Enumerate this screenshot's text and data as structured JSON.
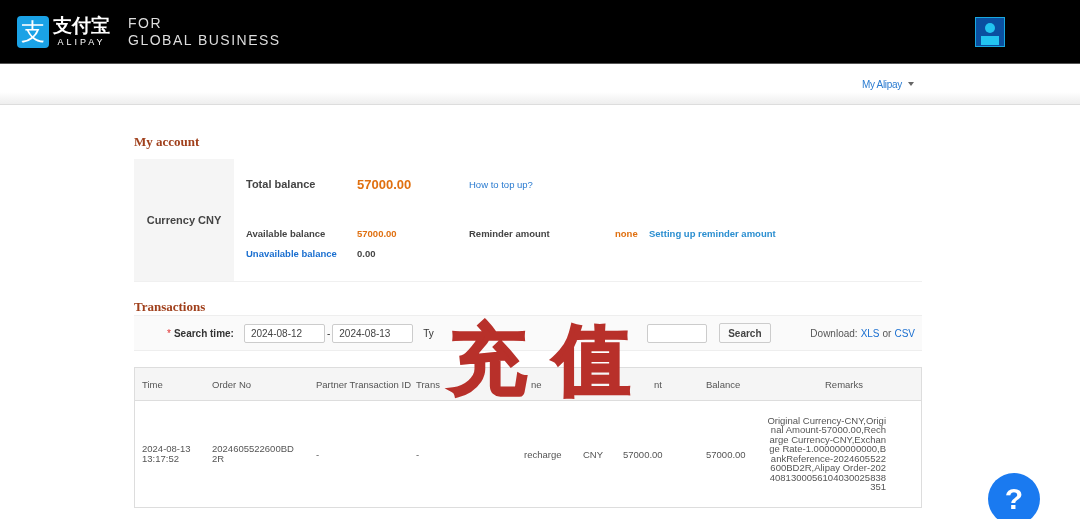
{
  "header": {
    "logo_glyph": "支",
    "logo_name": "支付宝",
    "logo_latin": "ALIPAY",
    "tagline": [
      "FOR",
      "GLOBAL BUSINESS"
    ]
  },
  "nav": {
    "menu": "My Alipay"
  },
  "account": {
    "title": "My account",
    "currency": "Currency CNY",
    "total_label": "Total balance",
    "total_value": "57000.00",
    "top_up_link": "How to top up?",
    "available_label": "Available balance",
    "available_value": "57000.00",
    "reminder_label": "Reminder amount",
    "reminder_value": "none",
    "reminder_link": "Setting up reminder amount",
    "unavailable_link": "Unavailable balance",
    "unavailable_value": "0.00"
  },
  "transactions": {
    "title": "Transactions",
    "required_mark": "*",
    "search_label": "Search time:",
    "date_from": "2024-08-12",
    "date_to": "2024-08-13",
    "date_sep": "-",
    "type_label": "Ty",
    "search_button": "Search",
    "download_label": "Download:",
    "download_links": [
      "XLS",
      "CSV"
    ],
    "download_or": "or",
    "columns": [
      "Time",
      "Order No",
      "Partner Transaction ID",
      "Trans",
      "",
      "ne",
      "",
      "nt",
      "Balance",
      "Remarks"
    ],
    "rows": [
      [
        "2024-08-13 13:17:52",
        "2024605522600BD2R",
        "-",
        "-",
        "",
        "recharge",
        "CNY",
        "57000.00",
        "57000.00",
        "Original Currency-CNY,Original Amount-57000.00,Recharge Currency-CNY,Exchange Rate-1.000000000000,BankReference-2024605522600BD2R,Alipay Order-2024081300056104030025838351"
      ]
    ]
  },
  "overlay_characters": [
    "充",
    "值"
  ],
  "help_button": "?"
}
